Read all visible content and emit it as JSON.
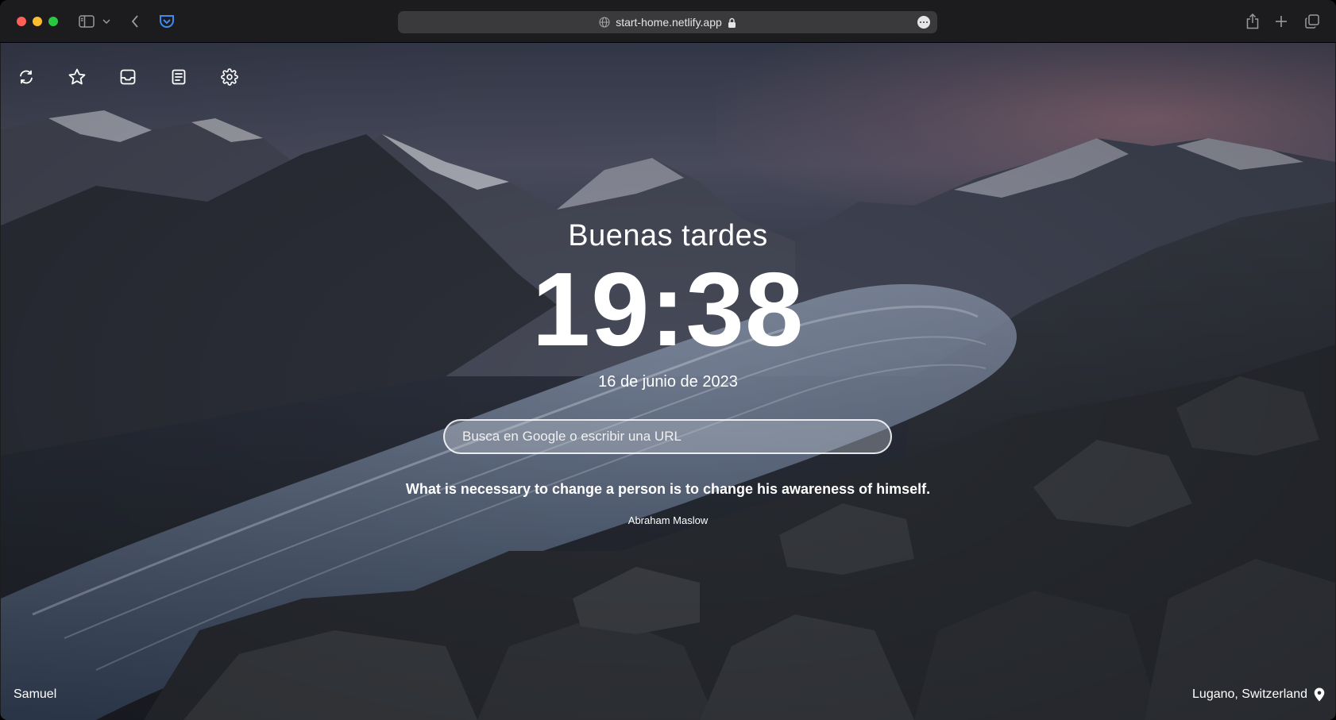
{
  "browser": {
    "url": "start-home.netlify.app"
  },
  "toolbar": {
    "icons": [
      "refresh-icon",
      "star-icon",
      "inbox-icon",
      "notes-icon",
      "settings-icon"
    ]
  },
  "main": {
    "greeting": "Buenas tardes",
    "time": "19:38",
    "date": "16 de junio de 2023",
    "search_placeholder": "Busca en Google o escribir una URL",
    "quote": "What is necessary to change a person is to change his awareness of himself.",
    "quote_author": "Abraham Maslow"
  },
  "footer": {
    "user_name": "Samuel",
    "location": "Lugano, Switzerland"
  },
  "colors": {
    "chrome_background": "#1c1c1e",
    "address_bar": "#3a3a3c",
    "traffic_red": "#ff5f57",
    "traffic_yellow": "#febc2e",
    "traffic_green": "#28c840",
    "pocket_accent": "#3c8cf2"
  }
}
